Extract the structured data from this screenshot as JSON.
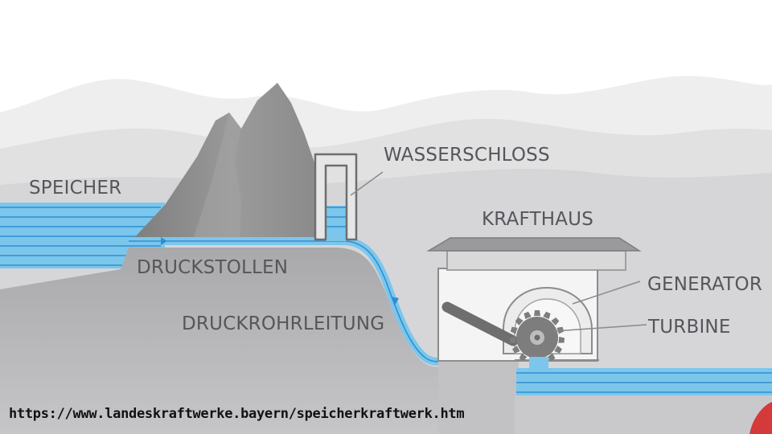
{
  "labels": {
    "speicher": "SPEICHER",
    "wasserschloss": "WASSERSCHLOSS",
    "krafthaus": "KRAFTHAUS",
    "druckstollen": "DRUCKSTOLLEN",
    "generator": "GENERATOR",
    "druckrohrleitung": "DRUCKROHRLEITUNG",
    "turbine": "TURBINE"
  },
  "source_url": "https://www.landeskraftwerke.bayern/speicherkraftwerk.htm",
  "colors": {
    "water": "#7cc6ec",
    "water_line": "#2e8fd0",
    "rock": "#8a8a8a",
    "ground": "#b4b4b6",
    "label": "#55565b"
  }
}
